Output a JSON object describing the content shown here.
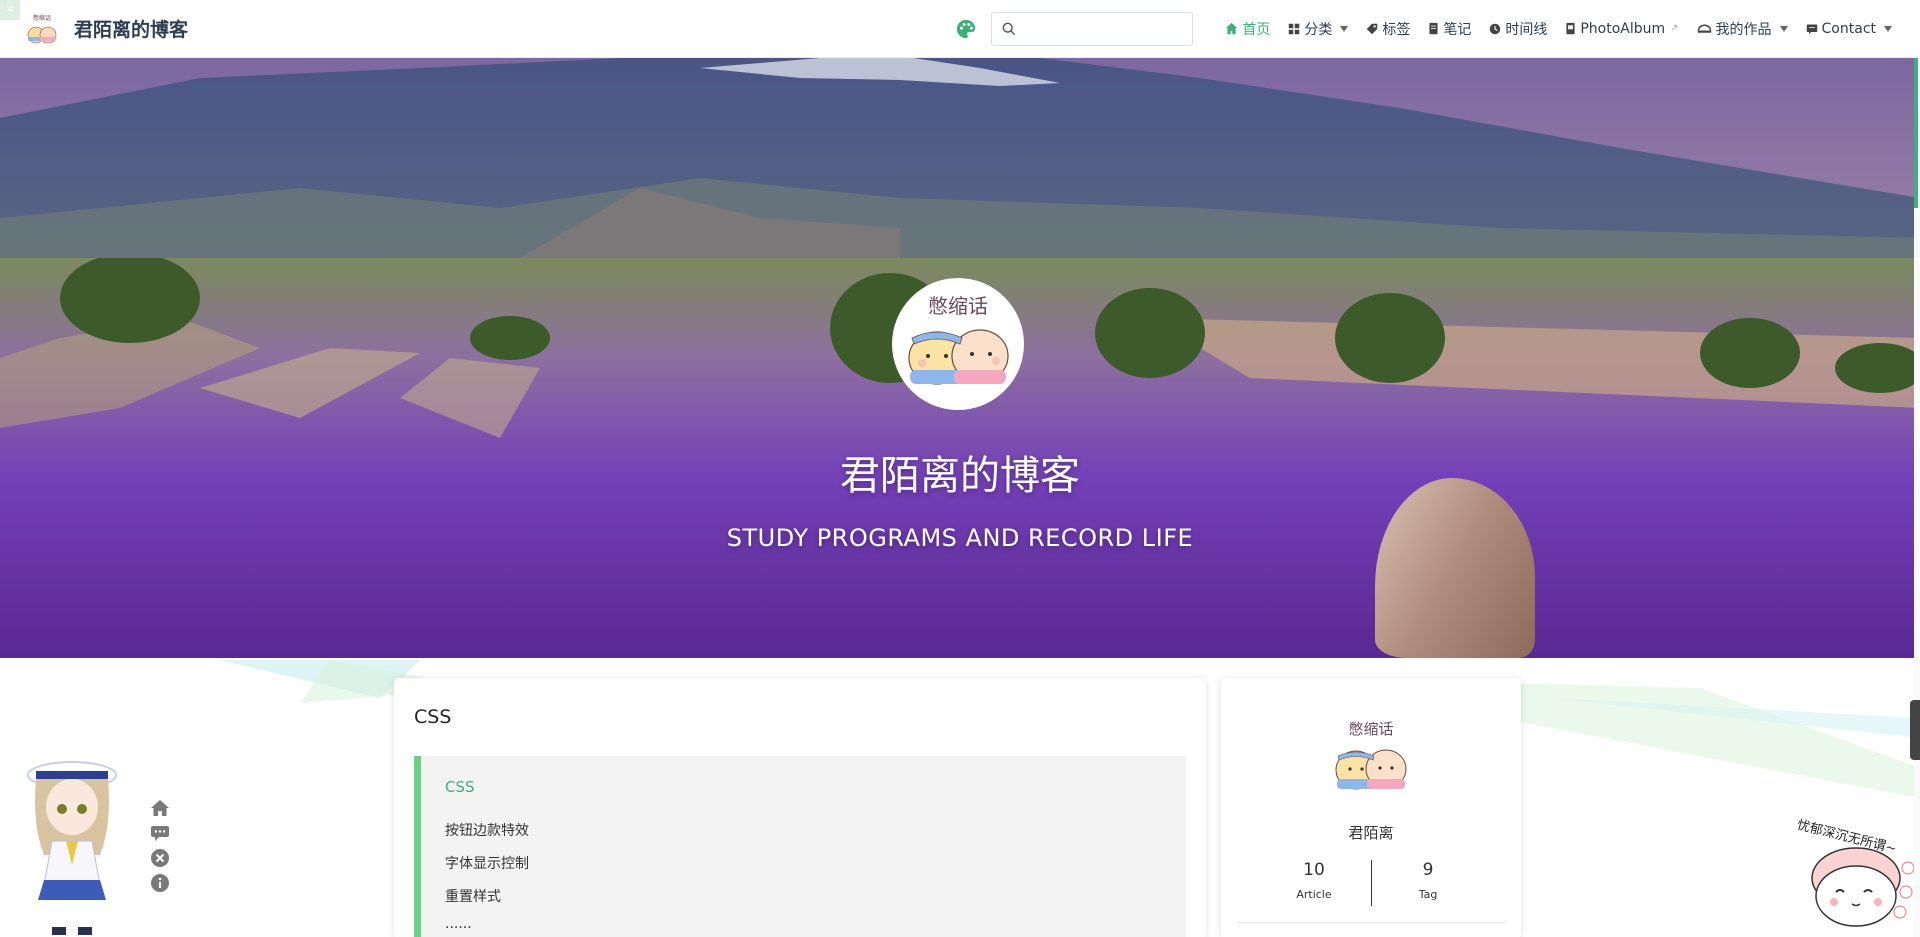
{
  "brand": {
    "title": "君陌离的博客"
  },
  "nav": {
    "search_placeholder": "",
    "items": [
      {
        "label": "首页",
        "icon": "home-icon",
        "active": true
      },
      {
        "label": "分类",
        "icon": "grid-icon",
        "dropdown": true
      },
      {
        "label": "标签",
        "icon": "tag-icon"
      },
      {
        "label": "笔记",
        "icon": "book-icon"
      },
      {
        "label": "时间线",
        "icon": "clock-icon"
      },
      {
        "label": "PhotoAlbum",
        "icon": "album-icon",
        "external": true
      },
      {
        "label": "我的作品",
        "icon": "works-icon",
        "dropdown": true
      },
      {
        "label": "Contact",
        "icon": "contact-icon",
        "dropdown": true
      }
    ]
  },
  "hero": {
    "avatar_text": "憋缩话",
    "title": "君陌离的博客",
    "subtitle": "STUDY PROGRAMS AND RECORD LIFE"
  },
  "main_card": {
    "title": "CSS",
    "quote": {
      "heading": "CSS",
      "items": [
        "按钮边款特效",
        "字体显示控制",
        "重置样式",
        "......"
      ]
    }
  },
  "side_card": {
    "avatar_text": "憋缩话",
    "name": "君陌离",
    "stats": [
      {
        "value": "10",
        "label": "Article"
      },
      {
        "value": "9",
        "label": "Tag"
      }
    ]
  },
  "sticker": {
    "text": "忧郁深沉无所谓~"
  },
  "colors": {
    "accent": "#3eaf7c",
    "quote_border": "#6fcf8a"
  }
}
